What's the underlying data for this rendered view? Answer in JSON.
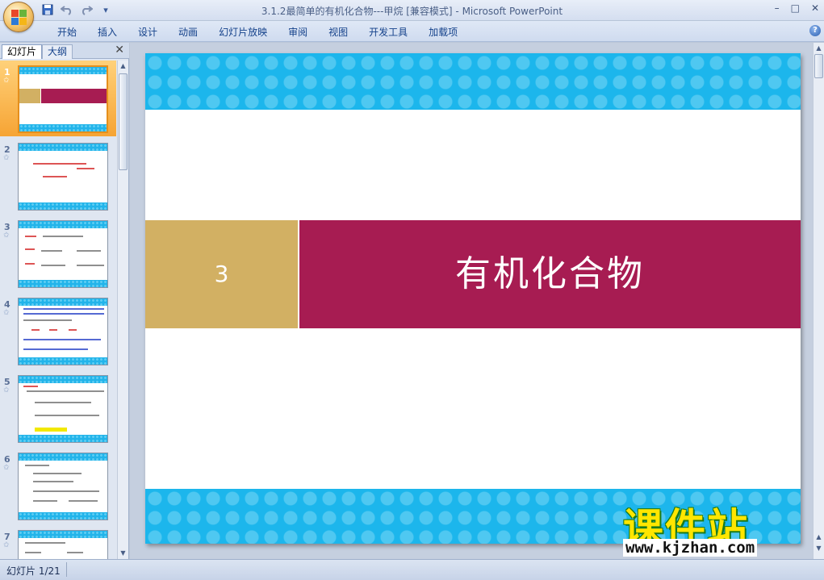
{
  "window": {
    "title": "3.1.2最简单的有机化合物---甲烷 [兼容模式] - Microsoft PowerPoint",
    "controls": [
      "–",
      "□",
      "✕"
    ]
  },
  "qat": {
    "save_icon": "save-icon",
    "undo_icon": "undo-icon",
    "redo_icon": "redo-icon"
  },
  "ribbon": {
    "tabs": [
      "开始",
      "插入",
      "设计",
      "动画",
      "幻灯片放映",
      "审阅",
      "视图",
      "开发工具",
      "加载项"
    ]
  },
  "left_panel": {
    "tabs": [
      "幻灯片",
      "大纲"
    ],
    "close": "✕",
    "slides": [
      {
        "num": "1",
        "star": "✩"
      },
      {
        "num": "2",
        "star": "✩"
      },
      {
        "num": "3",
        "star": "✩"
      },
      {
        "num": "4",
        "star": "✩"
      },
      {
        "num": "5",
        "star": "✩"
      },
      {
        "num": "6",
        "star": "✩"
      },
      {
        "num": "7",
        "star": "✩"
      }
    ]
  },
  "slide": {
    "number": "3",
    "title": "有机化合物"
  },
  "watermark": {
    "text": "课件站",
    "url": "www.kjzhan.com"
  },
  "status": {
    "slide_counter": "幻灯片 1/21"
  },
  "colors": {
    "band": "#1cb6ec",
    "number_box": "#d2b063",
    "title_box": "#a71c52",
    "selected_thumb": "#f6a434"
  }
}
